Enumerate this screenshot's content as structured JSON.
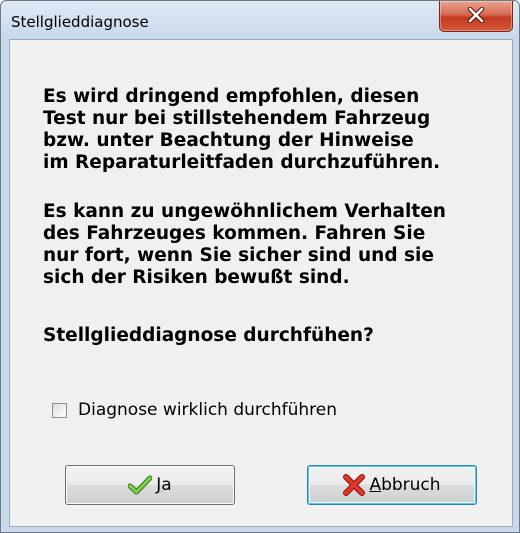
{
  "window": {
    "title": "Stellglieddiagnose"
  },
  "message": {
    "paragraph1": "Es wird dringend empfohlen, diesen\nTest nur bei stillstehendem Fahrzeug\nbzw. unter Beachtung der Hinweise\nim Reparaturleitfaden durchzuführen.",
    "paragraph2": "Es kann zu ungewöhnlichem Verhalten\ndes Fahrzeuges kommen. Fahren Sie\nnur fort, wenn Sie sicher sind und sie\nsich der Risiken bewußt sind.",
    "question": "Stellglieddiagnose durchfühen?"
  },
  "checkbox": {
    "label": "Diagnose wirklich durchführen",
    "checked": false
  },
  "buttons": {
    "ja": {
      "accel": "J",
      "rest": "a",
      "icon": "checkmark-icon",
      "color": "#4caf2a"
    },
    "abbruch": {
      "accel": "A",
      "rest": "bbruch",
      "icon": "red-x-icon",
      "color": "#d3261a"
    }
  },
  "colors": {
    "close_button": "#c7432a",
    "title_bar": "#c9d9ec",
    "client_background": "#f0f0f0",
    "default_button_border": "#3c7fb1"
  }
}
